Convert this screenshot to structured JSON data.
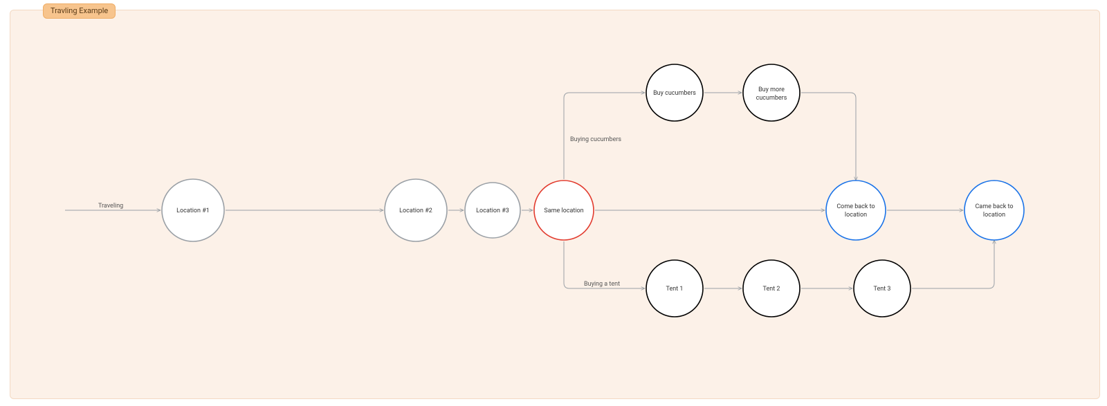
{
  "title": "Travling Example",
  "edgeLabels": {
    "traveling": "Traveling",
    "buyingCucumbers": "Buying cucumbers",
    "buyingTent": "Buying a tent"
  },
  "nodes": {
    "loc1": {
      "label": "Location #1"
    },
    "loc2": {
      "label": "Location #2"
    },
    "loc3": {
      "label": "Location #3"
    },
    "same": {
      "label": "Same location"
    },
    "buy1": {
      "label": "Buy cucumbers"
    },
    "buy2": {
      "label1": "Buy more",
      "label2": "cucumbers"
    },
    "tent1": {
      "label": "Tent 1"
    },
    "tent2": {
      "label": "Tent 2"
    },
    "tent3": {
      "label": "Tent 3"
    },
    "come": {
      "label1": "Come back to",
      "label2": "location"
    },
    "came": {
      "label1": "Came back to",
      "label2": "location"
    }
  }
}
